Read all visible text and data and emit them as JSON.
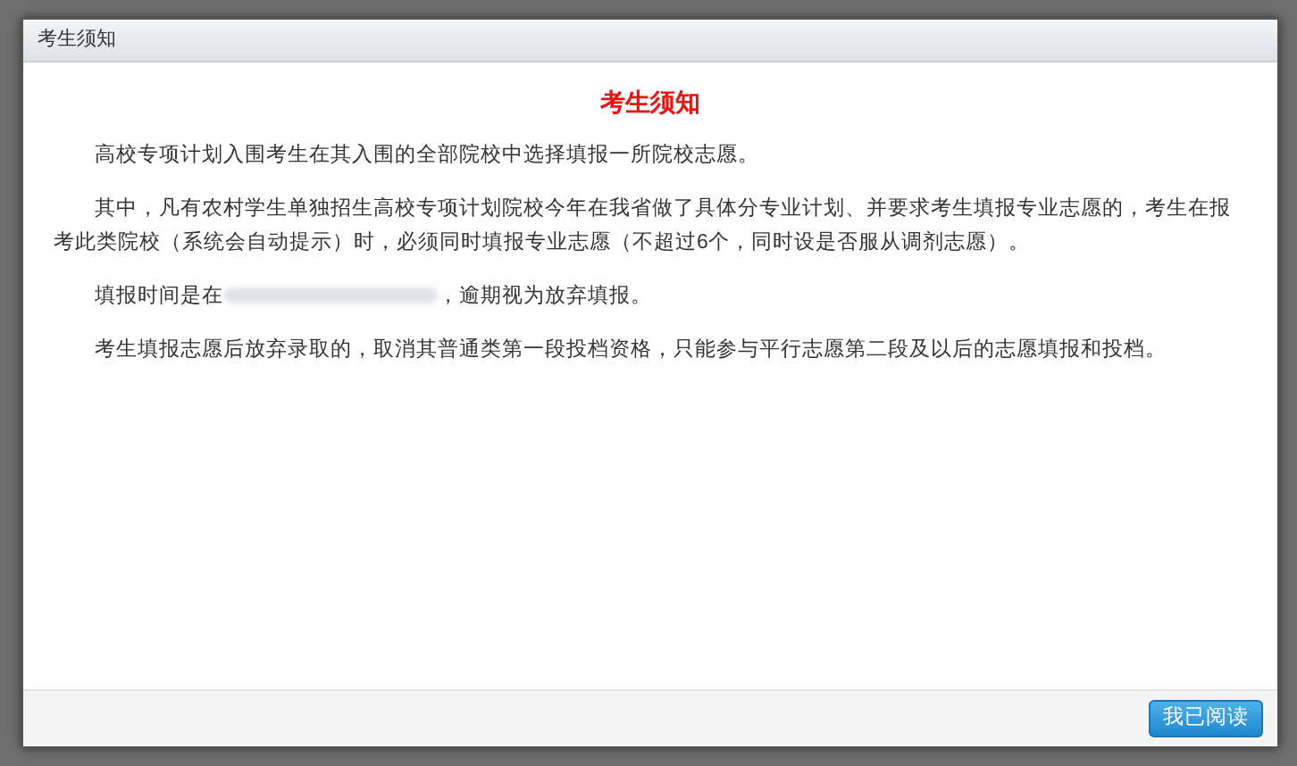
{
  "window": {
    "title": "考生须知"
  },
  "notice": {
    "heading": "考生须知",
    "paragraphs": [
      {
        "text": "高校专项计划入围考生在其入围的全部院校中选择填报一所院校志愿。",
        "redacted": false
      },
      {
        "text": "其中，凡有农村学生单独招生高校专项计划院校今年在我省做了具体分专业计划、并要求考生填报专业志愿的，考生在报考此类院校（系统会自动提示）时，必须同时填报专业志愿（不超过6个，同时设是否服从调剂志愿）。",
        "redacted": false
      },
      {
        "text": "填报时间是在",
        "redacted": true,
        "text_after": "，逾期视为放弃填报。"
      },
      {
        "text": "考生填报志愿后放弃录取的，取消其普通类第一段投档资格，只能参与平行志愿第二段及以后的志愿填报和投档。",
        "redacted": false
      }
    ]
  },
  "buttons": [
    {
      "label": "我已阅读"
    }
  ]
}
